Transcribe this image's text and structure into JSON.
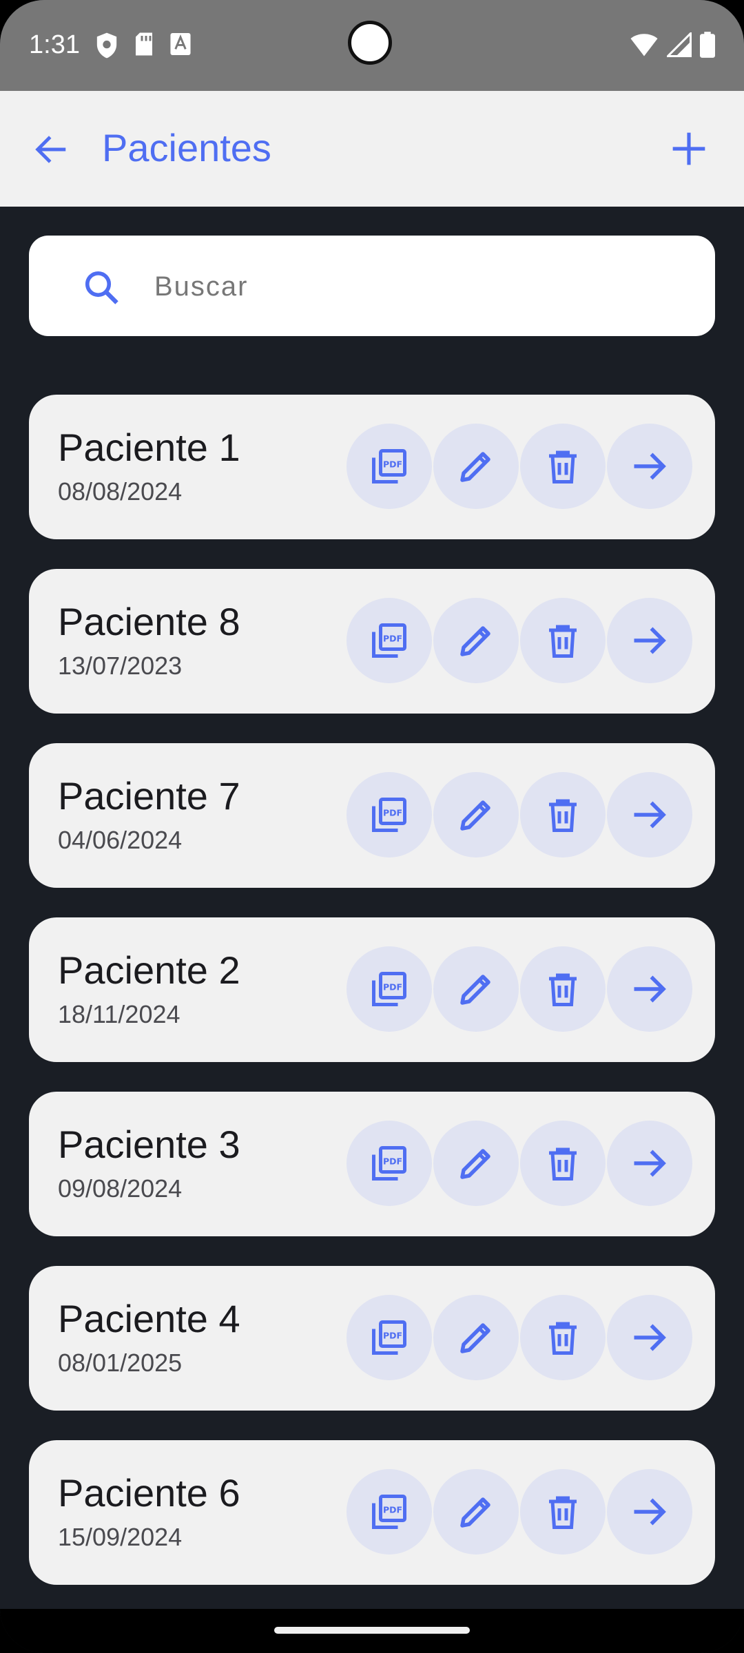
{
  "status": {
    "time": "1:31"
  },
  "app_bar": {
    "title": "Pacientes"
  },
  "search": {
    "placeholder": "Buscar"
  },
  "colors": {
    "accent": "#4f6ef2",
    "background": "#1a1e25",
    "card": "#f1f1f1",
    "action_bg": "#e0e3f2"
  },
  "patients": [
    {
      "name": "Paciente 1",
      "date": "08/08/2024"
    },
    {
      "name": "Paciente 8",
      "date": "13/07/2023"
    },
    {
      "name": "Paciente 7",
      "date": "04/06/2024"
    },
    {
      "name": "Paciente 2",
      "date": "18/11/2024"
    },
    {
      "name": "Paciente 3",
      "date": "09/08/2024"
    },
    {
      "name": "Paciente 4",
      "date": "08/01/2025"
    },
    {
      "name": "Paciente 6",
      "date": "15/09/2024"
    }
  ],
  "actions": [
    "pdf-icon",
    "edit-icon",
    "delete-icon",
    "arrow-forward-icon"
  ]
}
